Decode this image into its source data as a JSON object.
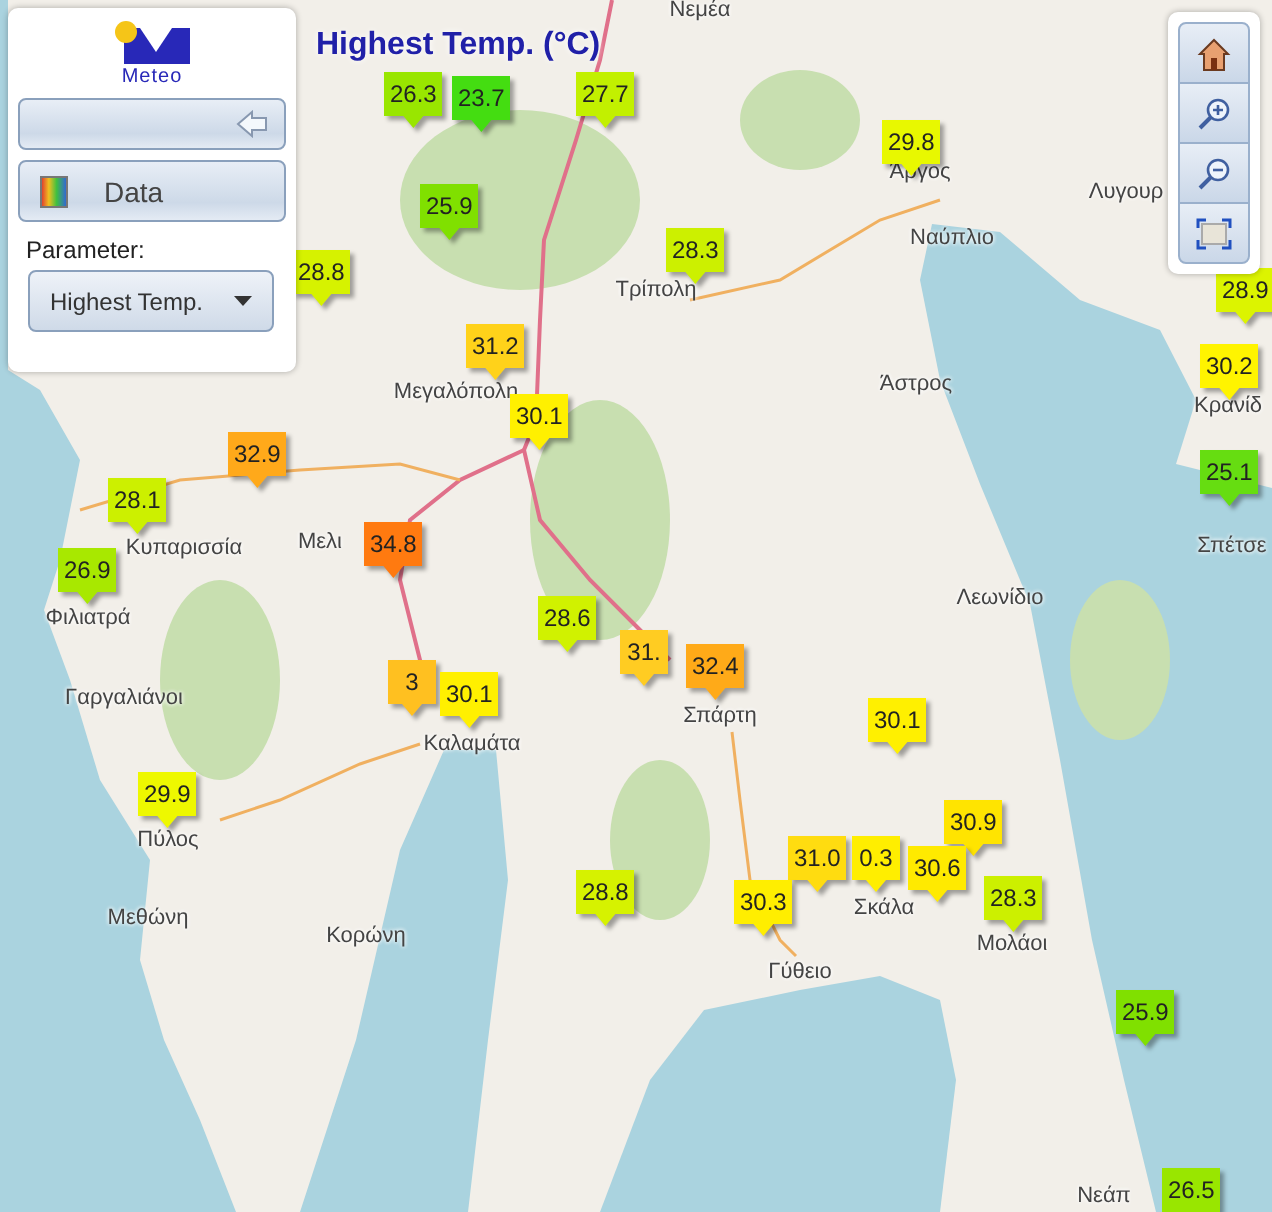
{
  "panel": {
    "logo_text": "Meteo",
    "data_button": "Data",
    "parameter_label": "Parameter:",
    "parameter_select": "Highest Temp."
  },
  "toolbar": [
    {
      "kind": "home"
    },
    {
      "kind": "zoom_in"
    },
    {
      "kind": "zoom_out"
    },
    {
      "kind": "extent"
    }
  ],
  "map": {
    "title": "Highest Temp. (°C)",
    "place_labels": [
      "Νεμέα",
      "Άργος",
      "Λυγουρ",
      "Ναύπλιο",
      "Τρίπολη",
      "Μεγαλόπολη",
      "Άστρος",
      "Κρανίδ",
      "Κυπαρισσία",
      "Μελι",
      "Σπέτσε",
      "Λεωνίδιο",
      "Φιλιατρά",
      "Γαργαλιάνοι",
      "Σπάρτη",
      "Καλαμάτα",
      "Πύλος",
      "Σκάλα",
      "Μεθώνη",
      "Κορώνη",
      "Μολάοι",
      "Γύθειο",
      "Νεάπ"
    ],
    "markers": [
      {
        "value": "26.3",
        "color": "#99e600"
      },
      {
        "value": "23.7",
        "color": "#44dd11"
      },
      {
        "value": "27.7",
        "color": "#c2f000"
      },
      {
        "value": "29.8",
        "color": "#e8f800"
      },
      {
        "value": "25.9",
        "color": "#80e000"
      },
      {
        "value": "28.8",
        "color": "#d6f200"
      },
      {
        "value": "28.3",
        "color": "#ccf000"
      },
      {
        "value": "28.9",
        "color": "#dcf400"
      },
      {
        "value": "31.2",
        "color": "#ffd21a"
      },
      {
        "value": "30.1",
        "color": "#fff000"
      },
      {
        "value": "30.2",
        "color": "#fff400"
      },
      {
        "value": "32.9",
        "color": "#ffa91a"
      },
      {
        "value": "25.1",
        "color": "#66dd11"
      },
      {
        "value": "28.1",
        "color": "#ccf000"
      },
      {
        "value": "34.8",
        "color": "#ff7a10"
      },
      {
        "value": "26.9",
        "color": "#a8e800"
      },
      {
        "value": "28.6",
        "color": "#d0f200"
      },
      {
        "value": "31.",
        "color": "#ffcc22"
      },
      {
        "value": "32.4",
        "color": "#ffaa18"
      },
      {
        "value": "3",
        "color": "#ffc020"
      },
      {
        "value": "30.1",
        "color": "#fff000"
      },
      {
        "value": "30.1",
        "color": "#fff000"
      },
      {
        "value": "29.9",
        "color": "#eef800"
      },
      {
        "value": "30.9",
        "color": "#ffe400"
      },
      {
        "value": "31.0",
        "color": "#ffdc10"
      },
      {
        "value": "0.3",
        "color": "#ffee00"
      },
      {
        "value": "30.6",
        "color": "#ffea00"
      },
      {
        "value": "28.8",
        "color": "#d6f200"
      },
      {
        "value": "30.3",
        "color": "#ffee00"
      },
      {
        "value": "28.3",
        "color": "#ccf000"
      },
      {
        "value": "25.9",
        "color": "#80e000"
      },
      {
        "value": "26.5",
        "color": "#99e600"
      }
    ]
  }
}
